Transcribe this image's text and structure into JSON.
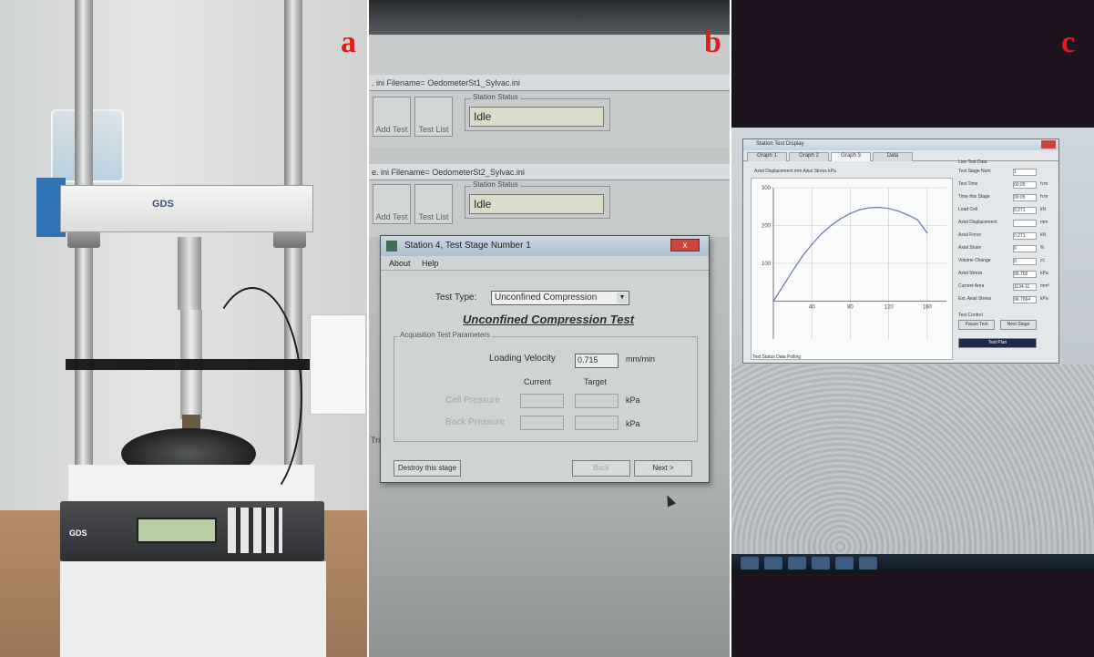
{
  "labels": {
    "a": "a",
    "b": "b",
    "c": "c"
  },
  "colors": {
    "label": "#e21b1b",
    "curve": "#6d6fb0",
    "close": "#c9463e",
    "field_idle": "#d9dcc8"
  },
  "panel_a": {
    "logo": "GDS",
    "console_brand": "GDS"
  },
  "panel_b": {
    "station1": {
      "header": ". ini Filename= OedometerSt1_Sylvac.ini",
      "add_test": "Add Test",
      "test_list": "Test List",
      "status_label": "Station Status",
      "status_value": "Idle"
    },
    "station2": {
      "header": "e. ini Filename= OedometerSt2_Sylvac.ini",
      "add_test": "Add Test",
      "test_list": "Test List",
      "status_label": "Station Status",
      "status_value": "Idle"
    },
    "dialog": {
      "title": "Station 4, Test Stage Number 1",
      "close": "x",
      "menu": [
        "About",
        "Help"
      ],
      "test_type_label": "Test Type:",
      "test_type_value": "Unconfined Compression",
      "heading": "Unconfined Compression Test",
      "group_label": "Acquisition Test Parameters",
      "loading_velocity_label": "Loading Velocity",
      "loading_velocity_value": "0.715",
      "loading_velocity_unit": "mm/min",
      "current_header": "Current",
      "target_header": "Target",
      "cell_pressure_label": "Cell Pressure",
      "cell_pressure_unit": "kPa",
      "back_pressure_label": "Back Pressure",
      "back_pressure_unit": "kPa",
      "destroy_button": "Destroy this stage",
      "back_button": "Back",
      "next_button": "Next >"
    },
    "side_fragment": "Triax"
  },
  "panel_c": {
    "window_title": "Station Test Display",
    "tabs": [
      "Graph 1",
      "Graph 2",
      "Graph 3",
      "Data"
    ],
    "active_tab": 2,
    "chart_title": "Axial Displacement mm  Axial Stress kPa",
    "side_header": "Live Test Data",
    "side_rows": [
      {
        "label": "Test Stage Num",
        "value": "1",
        "unit": ""
      },
      {
        "label": "Test Time",
        "value": "00:05",
        "unit": "h:m"
      },
      {
        "label": "Time this Stage",
        "value": "00:05",
        "unit": "h:m"
      },
      {
        "label": "Load Cell",
        "value": "0.271",
        "unit": "kN"
      },
      {
        "label": "Axial Displacement",
        "value": "",
        "unit": "mm"
      },
      {
        "label": "Axial Force",
        "value": "0.271",
        "unit": "kN"
      },
      {
        "label": "Axial Strain",
        "value": "0",
        "unit": "%"
      },
      {
        "label": "Volume Change",
        "value": "0",
        "unit": "cc"
      },
      {
        "label": "Axial Stress",
        "value": "96.702",
        "unit": "kPa"
      },
      {
        "label": "Current Area",
        "value": "1134.11",
        "unit": "mm²"
      },
      {
        "label": "Est. Axial Stress",
        "value": "96.7064",
        "unit": "kPa"
      }
    ],
    "test_control_label": "Test Control",
    "control_buttons": [
      "Pause Test",
      "Next Stage"
    ],
    "stop_button": "Test Plan",
    "status_text": "Test Status  Data Polling",
    "legend_items": [
      "Axial Displacement mm",
      "Axial Stress kPa"
    ]
  },
  "chart_data": {
    "type": "line",
    "title": "Axial Displacement mm  Axial Stress kPa",
    "xlabel": "",
    "ylabel": "",
    "x": [
      0,
      10,
      20,
      30,
      40,
      50,
      60,
      70,
      80,
      90,
      100,
      110,
      120,
      130,
      140,
      150,
      160
    ],
    "series": [
      {
        "name": "",
        "values": [
          0,
          40,
          80,
          118,
          150,
          178,
          200,
          218,
          232,
          242,
          247,
          248,
          245,
          238,
          228,
          215,
          180
        ]
      }
    ],
    "xlim": [
      0,
      180
    ],
    "ylim": [
      -100,
      300
    ],
    "xticks": [
      40,
      80,
      120,
      160
    ],
    "yticks": [
      100,
      200,
      300
    ],
    "grid": true
  }
}
